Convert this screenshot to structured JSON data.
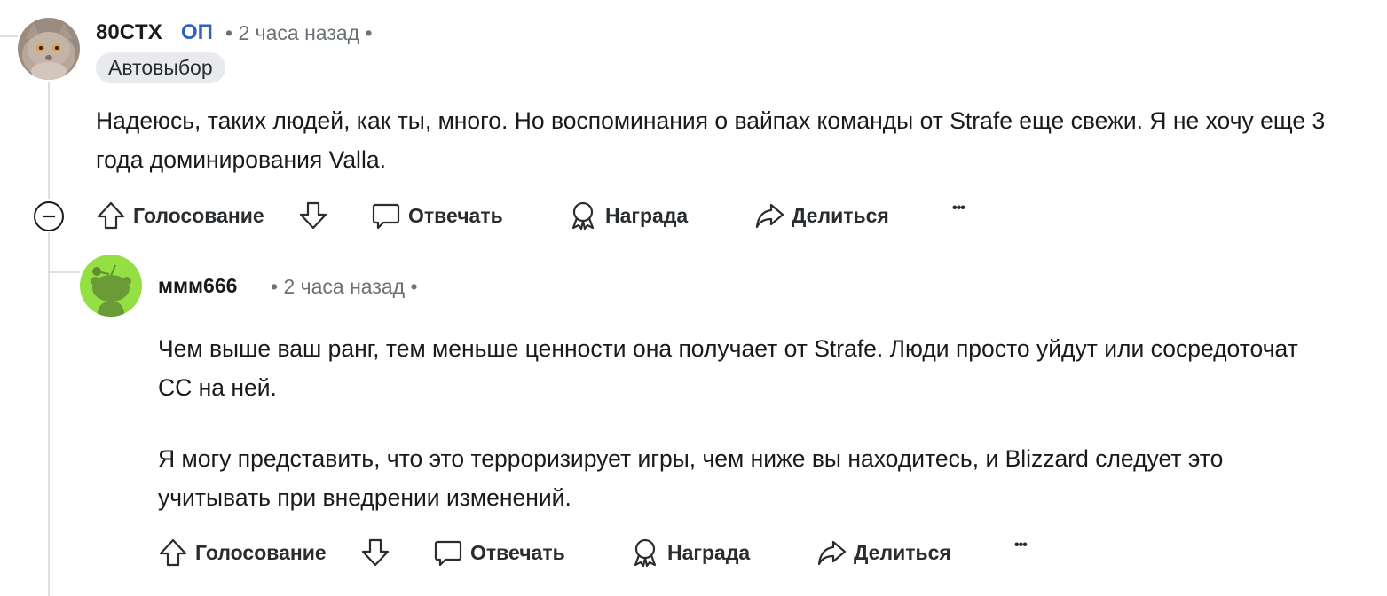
{
  "comments": [
    {
      "author": "80CTX",
      "op_badge": "ОП",
      "meta": "• 2 часа назад •",
      "flair": "Автовыбор",
      "body": [
        "Надеюсь, таких людей, как ты, много. Но воспоминания о вайпах команды от Strafe еще свежи. Я не хочу еще 3 года доминирования Valla."
      ],
      "actions": {
        "vote": "Голосование",
        "reply": "Отвечать",
        "award": "Награда",
        "share": "Делиться",
        "more": "•••"
      },
      "avatar_icon": "cat-avatar",
      "collapse_icon": "collapse-minus-icon"
    },
    {
      "author": "ммм666",
      "meta": "• 2 часа назад •",
      "body": [
        "Чем выше ваш ранг, тем меньше ценности она получает от Strafe. Люди просто уйдут или сосредоточат CC на ней.",
        "Я могу представить, что это терроризирует игры, чем ниже вы находитесь, и Blizzard следует это учитывать при внедрении изменений."
      ],
      "actions": {
        "vote": "Голосование",
        "reply": "Отвечать",
        "award": "Награда",
        "share": "Делиться",
        "more": "•••"
      },
      "avatar_icon": "snoo-avatar",
      "avatar_color": "#94e044"
    }
  ],
  "icons": [
    "upvote-icon",
    "downvote-icon",
    "reply-icon",
    "award-icon",
    "share-icon",
    "more-icon"
  ]
}
